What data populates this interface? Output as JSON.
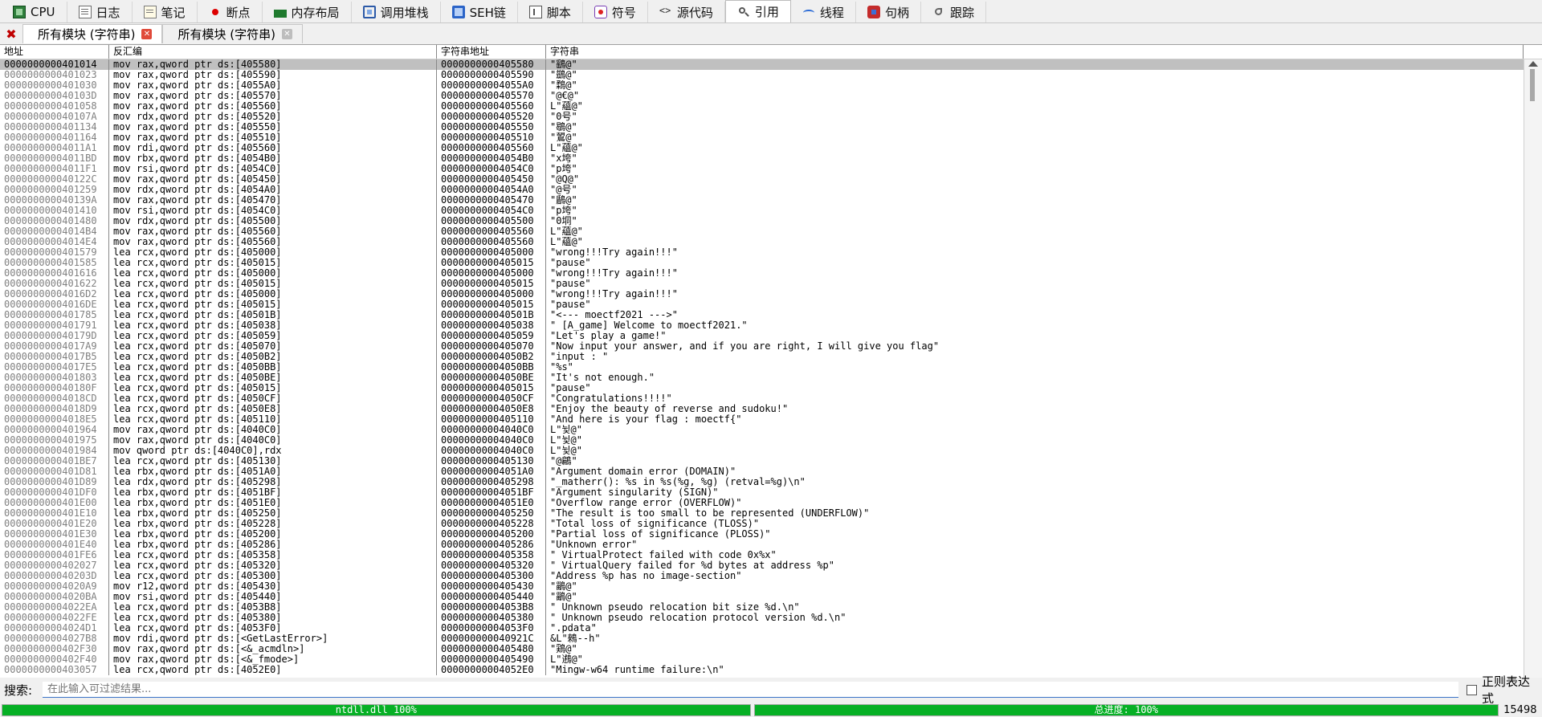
{
  "tabs": [
    {
      "label": "CPU",
      "icon": "cpu-icon"
    },
    {
      "label": "日志",
      "icon": "log-icon"
    },
    {
      "label": "笔记",
      "icon": "notes-icon"
    },
    {
      "label": "断点",
      "icon": "breakpoint-icon"
    },
    {
      "label": "内存布局",
      "icon": "memory-map-icon"
    },
    {
      "label": "调用堆栈",
      "icon": "call-stack-icon"
    },
    {
      "label": "SEH链",
      "icon": "seh-chain-icon"
    },
    {
      "label": "脚本",
      "icon": "script-icon"
    },
    {
      "label": "符号",
      "icon": "symbols-icon"
    },
    {
      "label": "源代码",
      "icon": "source-icon"
    },
    {
      "label": "引用",
      "icon": "references-icon",
      "active": true
    },
    {
      "label": "线程",
      "icon": "threads-icon"
    },
    {
      "label": "句柄",
      "icon": "handles-icon"
    },
    {
      "label": "跟踪",
      "icon": "trace-icon"
    }
  ],
  "subtabs": [
    "所有模块 (字符串)",
    "所有模块 (字符串)"
  ],
  "columns": [
    "地址",
    "反汇编",
    "字符串地址",
    "字符串"
  ],
  "rows": [
    [
      "0000000000401014",
      "mov rax,qword ptr ds:[405580]",
      "0000000000405580",
      "\"鷂@\""
    ],
    [
      "0000000000401023",
      "mov rax,qword ptr ds:[405590]",
      "0000000000405590",
      "\"鷀@\""
    ],
    [
      "0000000000401030",
      "mov rax,qword ptr ds:[4055A0]",
      "00000000004055A0",
      "\"鶔@\""
    ],
    [
      "000000000040103D",
      "mov rax,qword ptr ds:[405570]",
      "0000000000405570",
      "\"@€@\""
    ],
    [
      "0000000000401058",
      "mov rax,qword ptr ds:[405560]",
      "0000000000405560",
      "L\"蘊@\""
    ],
    [
      "000000000040107A",
      "mov rdx,qword ptr ds:[405520]",
      "0000000000405520",
      "\"0号\""
    ],
    [
      "0000000000401134",
      "mov rax,qword ptr ds:[405550]",
      "0000000000405550",
      "\"鶡@\""
    ],
    [
      "0000000000401164",
      "mov rax,qword ptr ds:[405510]",
      "0000000000405510",
      "\"鶦@\""
    ],
    [
      "00000000004011A1",
      "mov rdi,qword ptr ds:[405560]",
      "0000000000405560",
      "L\"蘊@\""
    ],
    [
      "00000000004011BD",
      "mov rbx,qword ptr ds:[4054B0]",
      "00000000004054B0",
      "\"x垮\""
    ],
    [
      "00000000004011F1",
      "mov rsi,qword ptr ds:[4054C0]",
      "00000000004054C0",
      "\"p垮\""
    ],
    [
      "000000000040122C",
      "mov rax,qword ptr ds:[405450]",
      "0000000000405450",
      "\"@Q@\""
    ],
    [
      "0000000000401259",
      "mov rdx,qword ptr ds:[4054A0]",
      "00000000004054A0",
      "\"@号\""
    ],
    [
      "000000000040139A",
      "mov rax,qword ptr ds:[405470]",
      "0000000000405470",
      "\"鶞@\""
    ],
    [
      "0000000000401410",
      "mov rsi,qword ptr ds:[4054C0]",
      "00000000004054C0",
      "\"p垮\""
    ],
    [
      "0000000000401480",
      "mov rdx,qword ptr ds:[405500]",
      "0000000000405500",
      "\"0垌\""
    ],
    [
      "00000000004014B4",
      "mov rax,qword ptr ds:[405560]",
      "0000000000405560",
      "L\"蘊@\""
    ],
    [
      "00000000004014E4",
      "mov rax,qword ptr ds:[405560]",
      "0000000000405560",
      "L\"蘊@\""
    ],
    [
      "0000000000401579",
      "lea rcx,qword ptr ds:[405000]",
      "0000000000405000",
      "\"wrong!!!Try again!!!\""
    ],
    [
      "0000000000401585",
      "lea rcx,qword ptr ds:[405015]",
      "0000000000405015",
      "\"pause\""
    ],
    [
      "0000000000401616",
      "lea rcx,qword ptr ds:[405000]",
      "0000000000405000",
      "\"wrong!!!Try again!!!\""
    ],
    [
      "0000000000401622",
      "lea rcx,qword ptr ds:[405015]",
      "0000000000405015",
      "\"pause\""
    ],
    [
      "00000000004016D2",
      "lea rcx,qword ptr ds:[405000]",
      "0000000000405000",
      "\"wrong!!!Try again!!!\""
    ],
    [
      "00000000004016DE",
      "lea rcx,qword ptr ds:[405015]",
      "0000000000405015",
      "\"pause\""
    ],
    [
      "0000000000401785",
      "lea rcx,qword ptr ds:[40501B]",
      "000000000040501B",
      "\"<---  moectf2021  --->\""
    ],
    [
      "0000000000401791",
      "lea rcx,qword ptr ds:[405038]",
      "0000000000405038",
      "\" [A_game] Welcome to moectf2021.\""
    ],
    [
      "000000000040179D",
      "lea rcx,qword ptr ds:[405059]",
      "0000000000405059",
      "\"Let's play a game!\""
    ],
    [
      "00000000004017A9",
      "lea rcx,qword ptr ds:[405070]",
      "0000000000405070",
      "\"Now input your answer, and if you are right, I will give you flag\""
    ],
    [
      "00000000004017B5",
      "lea rcx,qword ptr ds:[4050B2]",
      "00000000004050B2",
      "\"input : \""
    ],
    [
      "00000000004017E5",
      "lea rcx,qword ptr ds:[4050BB]",
      "00000000004050BB",
      "\"%s\""
    ],
    [
      "0000000000401803",
      "lea rcx,qword ptr ds:[4050BE]",
      "00000000004050BE",
      "\"It's not enough.\""
    ],
    [
      "000000000040180F",
      "lea rcx,qword ptr ds:[405015]",
      "0000000000405015",
      "\"pause\""
    ],
    [
      "00000000004018CD",
      "lea rcx,qword ptr ds:[4050CF]",
      "00000000004050CF",
      "\"Congratulations!!!!\""
    ],
    [
      "00000000004018D9",
      "lea rcx,qword ptr ds:[4050E8]",
      "00000000004050E8",
      "\"Enjoy the beauty of reverse and sudoku!\""
    ],
    [
      "00000000004018E5",
      "lea rcx,qword ptr ds:[405110]",
      "0000000000405110",
      "\"And here is your flag : moectf{\""
    ],
    [
      "0000000000401964",
      "mov rax,qword ptr ds:[4040C0]",
      "00000000004040C0",
      "L\"뉯@\""
    ],
    [
      "0000000000401975",
      "mov rax,qword ptr ds:[4040C0]",
      "00000000004040C0",
      "L\"뉯@\""
    ],
    [
      "0000000000401984",
      "mov qword ptr ds:[4040C0],rdx",
      "00000000004040C0",
      "L\"뉯@\""
    ],
    [
      "0000000000401BE7",
      "lea rcx,qword ptr ds:[405130]",
      "0000000000405130",
      "\"@鶣\""
    ],
    [
      "0000000000401D81",
      "lea rbx,qword ptr ds:[4051A0]",
      "00000000004051A0",
      "\"Argument domain error (DOMAIN)\""
    ],
    [
      "0000000000401D89",
      "lea rdx,qword ptr ds:[405298]",
      "0000000000405298",
      "\"_matherr(): %s in %s(%g, %g)  (retval=%g)\\n\""
    ],
    [
      "0000000000401DF0",
      "lea rbx,qword ptr ds:[4051BF]",
      "00000000004051BF",
      "\"Argument singularity (SIGN)\""
    ],
    [
      "0000000000401E00",
      "lea rbx,qword ptr ds:[4051E0]",
      "00000000004051E0",
      "\"Overflow range error (OVERFLOW)\""
    ],
    [
      "0000000000401E10",
      "lea rbx,qword ptr ds:[405250]",
      "0000000000405250",
      "\"The result is too small to be represented (UNDERFLOW)\""
    ],
    [
      "0000000000401E20",
      "lea rbx,qword ptr ds:[405228]",
      "0000000000405228",
      "\"Total loss of significance (TLOSS)\""
    ],
    [
      "0000000000401E30",
      "lea rbx,qword ptr ds:[405200]",
      "0000000000405200",
      "\"Partial loss of significance (PLOSS)\""
    ],
    [
      "0000000000401E40",
      "lea rbx,qword ptr ds:[405286]",
      "0000000000405286",
      "\"Unknown error\""
    ],
    [
      "0000000000401FE6",
      "lea rcx,qword ptr ds:[405358]",
      "0000000000405358",
      "\"  VirtualProtect failed with code 0x%x\""
    ],
    [
      "0000000000402027",
      "lea rcx,qword ptr ds:[405320]",
      "0000000000405320",
      "\"  VirtualQuery failed for %d bytes at address %p\""
    ],
    [
      "000000000040203D",
      "lea rcx,qword ptr ds:[405300]",
      "0000000000405300",
      "\"Address %p has no image-section\""
    ],
    [
      "00000000004020A9",
      "mov r12,qword ptr ds:[405430]",
      "0000000000405430",
      "\"鶅@\""
    ],
    [
      "00000000004020BA",
      "mov rsi,qword ptr ds:[405440]",
      "0000000000405440",
      "\"鶅@\""
    ],
    [
      "00000000004022EA",
      "lea rcx,qword ptr ds:[4053B8]",
      "00000000004053B8",
      "\"  Unknown pseudo relocation bit size %d.\\n\""
    ],
    [
      "00000000004022FE",
      "lea rcx,qword ptr ds:[405380]",
      "0000000000405380",
      "\"  Unknown pseudo relocation protocol version %d.\\n\""
    ],
    [
      "00000000004024D1",
      "lea rcx,qword ptr ds:[4053F0]",
      "00000000004053F0",
      "\".pdata\""
    ],
    [
      "00000000004027B8",
      "mov rdi,qword ptr ds:[<GetLastError>]",
      "000000000040921C",
      "&L\"鶆--h\""
    ],
    [
      "0000000000402F30",
      "mov rax,qword ptr ds:[<&_acmdln>]",
      "0000000000405480",
      "\"鶏@\""
    ],
    [
      "0000000000402F40",
      "mov rax,qword ptr ds:[<&_fmode>]",
      "0000000000405490",
      "L\"鶐@\""
    ],
    [
      "0000000000403057",
      "lea rcx,qword ptr ds:[4052E0]",
      "00000000004052E0",
      "\"Mingw-w64 runtime failure:\\n\""
    ]
  ],
  "search": {
    "label": "搜索:",
    "placeholder": "在此输入可过滤结果...",
    "regex_label": "正则表达式"
  },
  "status": {
    "left_text": "ntdll.dll 100%",
    "left_progress": 100,
    "right_text": "总进度: 100%",
    "right_progress": 100,
    "count": "15498",
    "accent": "#06b025"
  }
}
